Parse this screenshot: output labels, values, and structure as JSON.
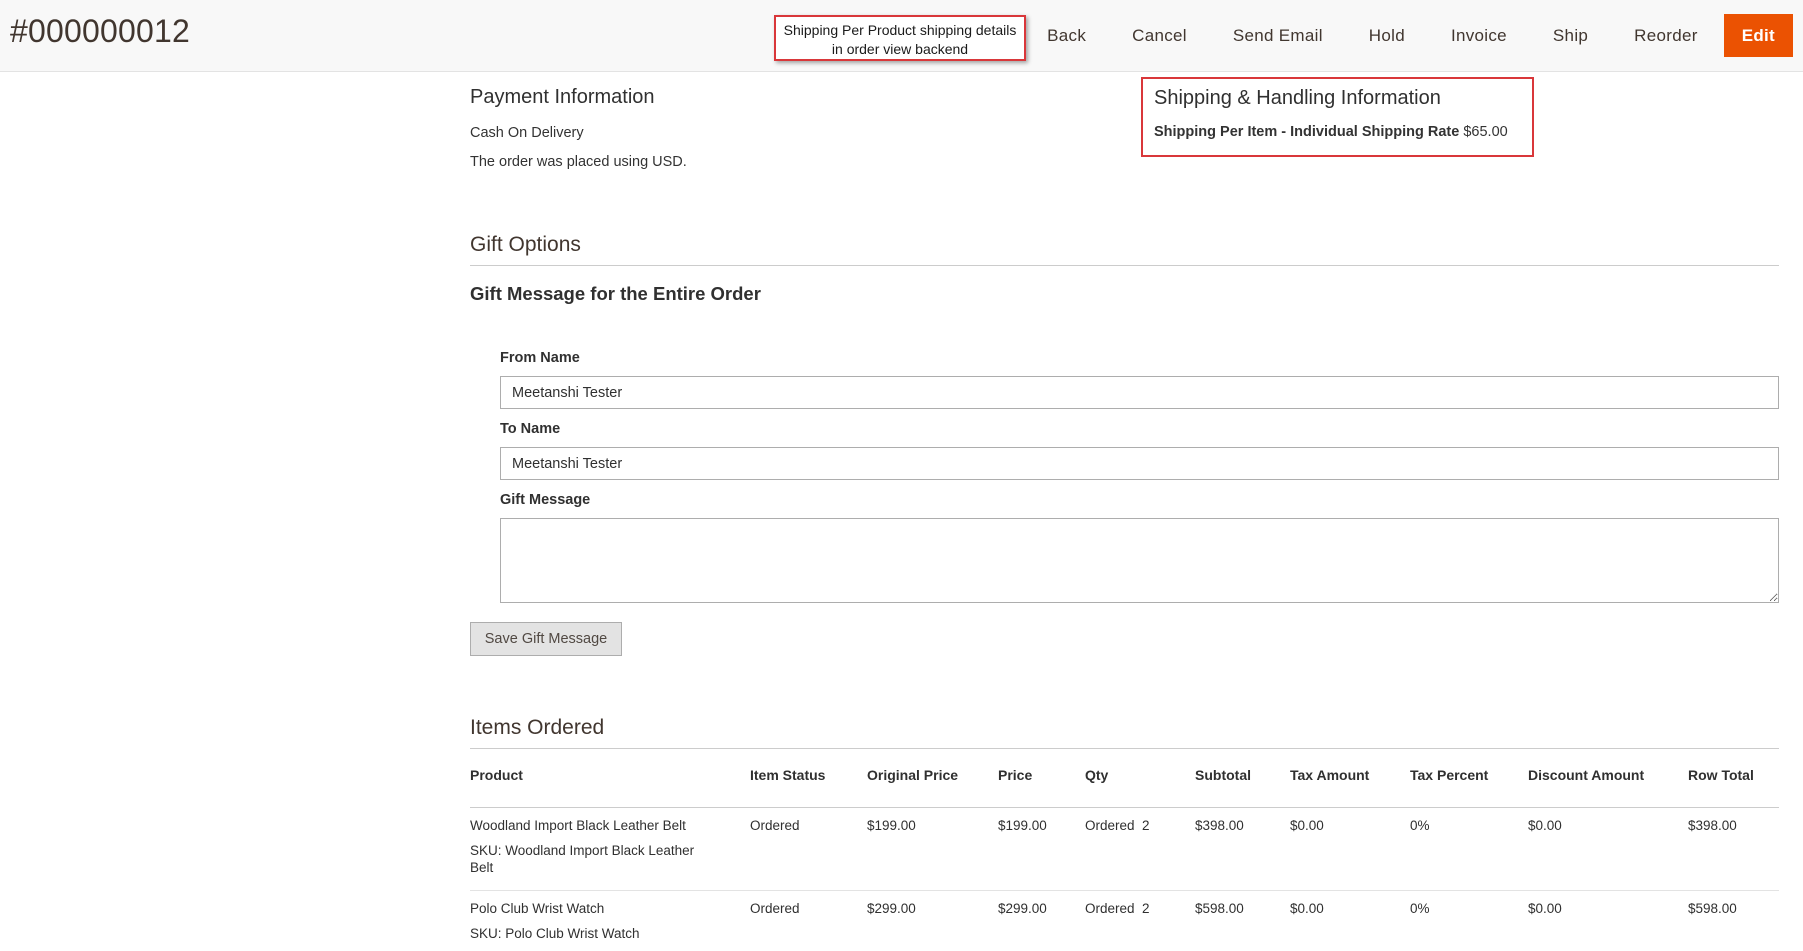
{
  "header": {
    "order_number": "#000000012",
    "annotation": [
      "Shipping Per Product shipping details",
      "in order view backend"
    ],
    "actions": [
      "Back",
      "Cancel",
      "Send Email",
      "Hold",
      "Invoice",
      "Ship",
      "Reorder",
      "Edit"
    ]
  },
  "payment": {
    "title": "Payment Information",
    "method": "Cash On Delivery",
    "currency_note": "The order was placed using USD."
  },
  "shipping": {
    "title": "Shipping & Handling Information",
    "method_label": "Shipping Per Item - Individual Shipping Rate",
    "amount": "$65.00"
  },
  "gift": {
    "section_title": "Gift Options",
    "subtitle": "Gift Message for the Entire Order",
    "from_label": "From Name",
    "from_value": "Meetanshi Tester",
    "to_label": "To Name",
    "to_value": "Meetanshi Tester",
    "message_label": "Gift Message",
    "message_value": "",
    "save_label": "Save Gift Message"
  },
  "items": {
    "section_title": "Items Ordered",
    "columns": [
      "Product",
      "Item Status",
      "Original Price",
      "Price",
      "Qty",
      "Subtotal",
      "Tax Amount",
      "Tax Percent",
      "Discount Amount",
      "Row Total"
    ],
    "rows": [
      {
        "product": "Woodland Import Black Leather Belt",
        "sku": "SKU: Woodland Import Black Leather Belt",
        "status": "Ordered",
        "original_price": "$199.00",
        "price": "$199.00",
        "qty_label": "Ordered",
        "qty": "2",
        "subtotal": "$398.00",
        "tax_amount": "$0.00",
        "tax_percent": "0%",
        "discount": "$0.00",
        "row_total": "$398.00"
      },
      {
        "product": "Polo Club Wrist Watch",
        "sku": "SKU: Polo Club Wrist Watch",
        "status": "Ordered",
        "original_price": "$299.00",
        "price": "$299.00",
        "qty_label": "Ordered",
        "qty": "2",
        "subtotal": "$598.00",
        "tax_amount": "$0.00",
        "tax_percent": "0%",
        "discount": "$0.00",
        "row_total": "$598.00"
      }
    ]
  },
  "colors": {
    "primary_button": "#eb5202",
    "annotation_border": "#d9373a",
    "header_bg": "#f8f8f8"
  }
}
